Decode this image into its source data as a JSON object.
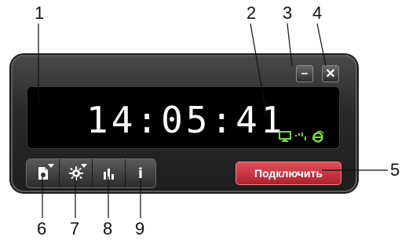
{
  "callouts": {
    "c1": "1",
    "c2": "2",
    "c3": "3",
    "c4": "4",
    "c5": "5",
    "c6": "6",
    "c7": "7",
    "c8": "8",
    "c9": "9"
  },
  "window": {
    "minimize_label": "–",
    "close_label": "✕"
  },
  "display": {
    "time": "14:05:41",
    "status_icons": [
      "monitor-icon",
      "signal-icon",
      "ie-icon"
    ]
  },
  "toolbar": {
    "buttons": [
      "document-icon",
      "settings-icon",
      "stats-icon",
      "info-icon"
    ],
    "info_label": "i"
  },
  "connect_button": {
    "label": "Подключить"
  },
  "colors": {
    "accent_green": "#7ad83a",
    "connect_red": "#c8303c"
  }
}
